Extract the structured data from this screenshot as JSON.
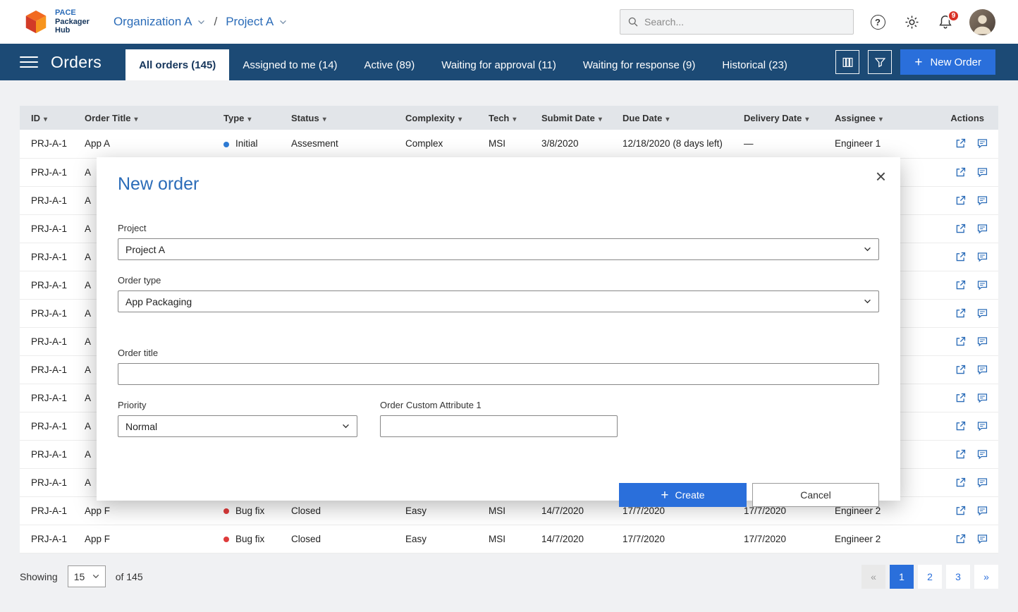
{
  "colors": {
    "navbar_navy": "#1c4a75",
    "accent_blue": "#2b6cb8",
    "button_blue": "#2a6fdb",
    "dot_blue": "#2e7cd6",
    "dot_red": "#de3b3b",
    "badge_red": "#d93025",
    "table_header_bg": "#e2e5e9",
    "page_bg": "#f0f1f3"
  },
  "topbar": {
    "logo": {
      "line1": "PACE",
      "line2": "Packager",
      "line3": "Hub"
    },
    "breadcrumb": {
      "org": "Organization A",
      "separator": "/",
      "project": "Project A"
    },
    "search": {
      "placeholder": "Search..."
    },
    "notifications_badge": "9"
  },
  "navbar": {
    "title": "Orders",
    "tabs": [
      {
        "label": "All orders (145)",
        "active": true
      },
      {
        "label": "Assigned to me (14)",
        "active": false
      },
      {
        "label": "Active (89)",
        "active": false
      },
      {
        "label": "Waiting for approval (11)",
        "active": false
      },
      {
        "label": "Waiting for response (9)",
        "active": false
      },
      {
        "label": "Historical (23)",
        "active": false
      }
    ],
    "new_order_label": "New Order"
  },
  "table": {
    "columns": [
      {
        "label": "ID",
        "sortable": true
      },
      {
        "label": "Order Title",
        "sortable": true
      },
      {
        "label": "Type",
        "sortable": true
      },
      {
        "label": "Status",
        "sortable": true
      },
      {
        "label": "Complexity",
        "sortable": true
      },
      {
        "label": "Tech",
        "sortable": true
      },
      {
        "label": "Submit Date",
        "sortable": true
      },
      {
        "label": "Due Date",
        "sortable": true
      },
      {
        "label": "Delivery Date",
        "sortable": true
      },
      {
        "label": "Assignee",
        "sortable": true
      },
      {
        "label": "Actions",
        "sortable": false
      }
    ],
    "rows": [
      {
        "id": "PRJ-A-1",
        "title": "App A",
        "dot": "blue",
        "type": "Initial",
        "status": "Assesment",
        "complexity": "Complex",
        "tech": "MSI",
        "submit": "3/8/2020",
        "due": "12/18/2020 (8 days left)",
        "delivery": "—",
        "assignee": "Engineer 1"
      },
      {
        "id": "PRJ-A-1",
        "title": "A",
        "dot": "",
        "type": "",
        "status": "",
        "complexity": "",
        "tech": "",
        "submit": "",
        "due": "",
        "delivery": "",
        "assignee": ""
      },
      {
        "id": "PRJ-A-1",
        "title": "A",
        "dot": "",
        "type": "",
        "status": "",
        "complexity": "",
        "tech": "",
        "submit": "",
        "due": "",
        "delivery": "",
        "assignee": ""
      },
      {
        "id": "PRJ-A-1",
        "title": "A",
        "dot": "",
        "type": "",
        "status": "",
        "complexity": "",
        "tech": "",
        "submit": "",
        "due": "",
        "delivery": "",
        "assignee": ""
      },
      {
        "id": "PRJ-A-1",
        "title": "A",
        "dot": "",
        "type": "",
        "status": "",
        "complexity": "",
        "tech": "",
        "submit": "",
        "due": "",
        "delivery": "",
        "assignee": ""
      },
      {
        "id": "PRJ-A-1",
        "title": "A",
        "dot": "",
        "type": "",
        "status": "",
        "complexity": "",
        "tech": "",
        "submit": "",
        "due": "",
        "delivery": "",
        "assignee": ""
      },
      {
        "id": "PRJ-A-1",
        "title": "A",
        "dot": "",
        "type": "",
        "status": "",
        "complexity": "",
        "tech": "",
        "submit": "",
        "due": "",
        "delivery": "",
        "assignee": ""
      },
      {
        "id": "PRJ-A-1",
        "title": "A",
        "dot": "",
        "type": "",
        "status": "",
        "complexity": "",
        "tech": "",
        "submit": "",
        "due": "",
        "delivery": "",
        "assignee": ""
      },
      {
        "id": "PRJ-A-1",
        "title": "A",
        "dot": "",
        "type": "",
        "status": "",
        "complexity": "",
        "tech": "",
        "submit": "",
        "due": "",
        "delivery": "",
        "assignee": ""
      },
      {
        "id": "PRJ-A-1",
        "title": "A",
        "dot": "",
        "type": "",
        "status": "",
        "complexity": "",
        "tech": "",
        "submit": "",
        "due": "",
        "delivery": "",
        "assignee": ""
      },
      {
        "id": "PRJ-A-1",
        "title": "A",
        "dot": "",
        "type": "",
        "status": "",
        "complexity": "",
        "tech": "",
        "submit": "",
        "due": "",
        "delivery": "",
        "assignee": ""
      },
      {
        "id": "PRJ-A-1",
        "title": "A",
        "dot": "",
        "type": "",
        "status": "",
        "complexity": "",
        "tech": "",
        "submit": "",
        "due": "",
        "delivery": "",
        "assignee": ""
      },
      {
        "id": "PRJ-A-1",
        "title": "A",
        "dot": "",
        "type": "",
        "status": "",
        "complexity": "",
        "tech": "",
        "submit": "",
        "due": "",
        "delivery": "",
        "assignee": ""
      },
      {
        "id": "PRJ-A-1",
        "title": "App F",
        "dot": "red",
        "type": "Bug fix",
        "status": "Closed",
        "complexity": "Easy",
        "tech": "MSI",
        "submit": "14/7/2020",
        "due": "17/7/2020",
        "delivery": "17/7/2020",
        "assignee": "Engineer 2"
      },
      {
        "id": "PRJ-A-1",
        "title": "App F",
        "dot": "red",
        "type": "Bug fix",
        "status": "Closed",
        "complexity": "Easy",
        "tech": "MSI",
        "submit": "14/7/2020",
        "due": "17/7/2020",
        "delivery": "17/7/2020",
        "assignee": "Engineer 2"
      }
    ]
  },
  "modal": {
    "title": "New order",
    "fields": {
      "project": {
        "label": "Project",
        "value": "Project A"
      },
      "order_type": {
        "label": "Order type",
        "value": "App Packaging"
      },
      "order_title": {
        "label": "Order title",
        "value": ""
      },
      "priority": {
        "label": "Priority",
        "value": "Normal"
      },
      "custom_attr": {
        "label": "Order Custom Attribute 1",
        "value": ""
      }
    },
    "create_label": "Create",
    "cancel_label": "Cancel"
  },
  "footer": {
    "showing_label": "Showing",
    "page_size": "15",
    "of_text": "of 145",
    "pages": [
      "«",
      "1",
      "2",
      "3",
      "»"
    ]
  }
}
